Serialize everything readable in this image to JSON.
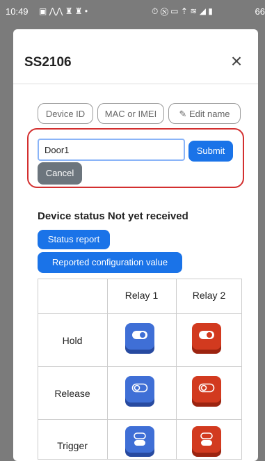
{
  "status_bar": {
    "time": "10:49",
    "left_icons": "▣ ⋀⋀ ♜ ♜ •",
    "right_icons": "⏱ Ⓝ ▭ ⇡ ≋ ◢ ▮",
    "battery": "66"
  },
  "modal": {
    "title": "SS2106",
    "close_label": "×"
  },
  "actions": {
    "device_id": "Device ID",
    "mac_imei": "MAC or IMEI",
    "edit_name": "✎ Edit name"
  },
  "edit": {
    "name_value": "Door1",
    "submit": "Submit",
    "cancel": "Cancel"
  },
  "status": {
    "title": "Device status Not yet received",
    "status_report": "Status report",
    "reported_config": "Reported configuration value"
  },
  "table": {
    "headers": [
      "",
      "Relay 1",
      "Relay 2"
    ],
    "rows": [
      {
        "label": "Hold",
        "icon": "toggle-on-icon"
      },
      {
        "label": "Release",
        "icon": "toggle-off-icon"
      },
      {
        "label": "Trigger",
        "icon": "toggle-trigger-icon"
      }
    ]
  },
  "colors": {
    "primary": "#1a73e8",
    "secondary": "#6c757d",
    "highlight_border": "#d32f2f",
    "relay1": "#3f6fd6",
    "relay2": "#d23a1f"
  }
}
